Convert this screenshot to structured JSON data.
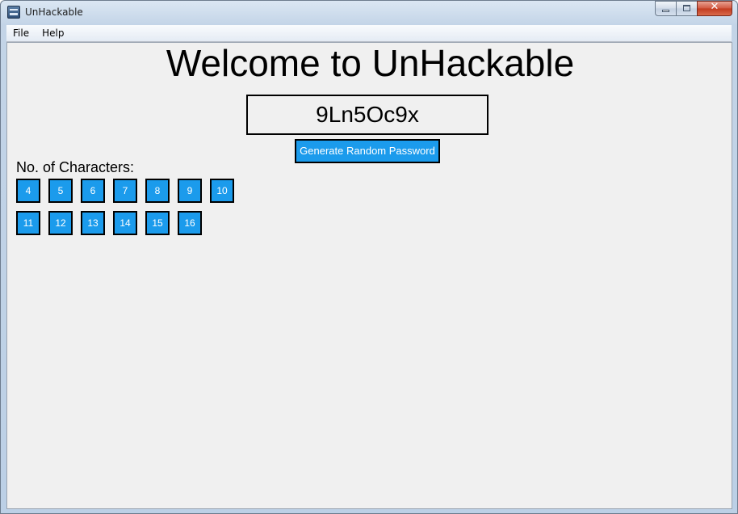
{
  "window": {
    "title": "UnHackable"
  },
  "menu": {
    "items": [
      "File",
      "Help"
    ]
  },
  "main": {
    "heading": "Welcome to UnHackable",
    "password": "9Ln5Oc9x",
    "generate_label": "Generate Random Password",
    "chars_label": "No. of Characters:",
    "lengths": [
      "4",
      "5",
      "6",
      "7",
      "8",
      "9",
      "10",
      "11",
      "12",
      "13",
      "14",
      "15",
      "16"
    ]
  },
  "colors": {
    "button_fill": "#1b9bec",
    "button_border": "#000000",
    "background": "#f0f0f0"
  },
  "icons": {
    "app": "app-window-icon",
    "minimize": "minimize-icon",
    "maximize": "maximize-icon",
    "close": "close-icon"
  }
}
